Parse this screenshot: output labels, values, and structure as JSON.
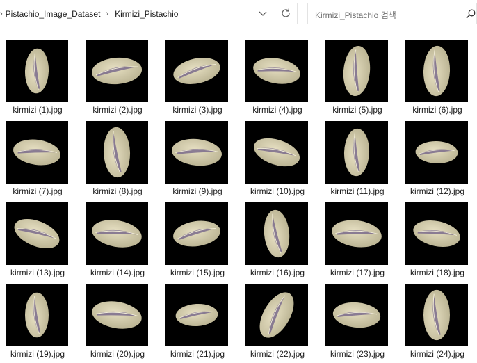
{
  "breadcrumb": {
    "items": [
      "Pistachio_Image_Dataset",
      "Kirmizi_Pistachio"
    ]
  },
  "search": {
    "placeholder": "Kirmizi_Pistachio 검색"
  },
  "icons": {
    "dropdown": "chevron-down-icon",
    "refresh": "refresh-icon",
    "search": "search-icon",
    "separator": "chevron-right-icon"
  },
  "files": [
    "kirmizi (1).jpg",
    "kirmizi (2).jpg",
    "kirmizi (3).jpg",
    "kirmizi (4).jpg",
    "kirmizi (5).jpg",
    "kirmizi (6).jpg",
    "kirmizi (7).jpg",
    "kirmizi (8).jpg",
    "kirmizi (9).jpg",
    "kirmizi (10).jpg",
    "kirmizi (11).jpg",
    "kirmizi (12).jpg",
    "kirmizi (13).jpg",
    "kirmizi (14).jpg",
    "kirmizi (15).jpg",
    "kirmizi (16).jpg",
    "kirmizi (17).jpg",
    "kirmizi (18).jpg",
    "kirmizi (19).jpg",
    "kirmizi (20).jpg",
    "kirmizi (21).jpg",
    "kirmizi (22).jpg",
    "kirmizi (23).jpg",
    "kirmizi (24).jpg"
  ],
  "colors": {
    "thumb_bg": "#000000",
    "nut_shell": "#e6dfc2",
    "nut_shade": "#b9b291",
    "nut_kernel": "#7a6b8c"
  }
}
